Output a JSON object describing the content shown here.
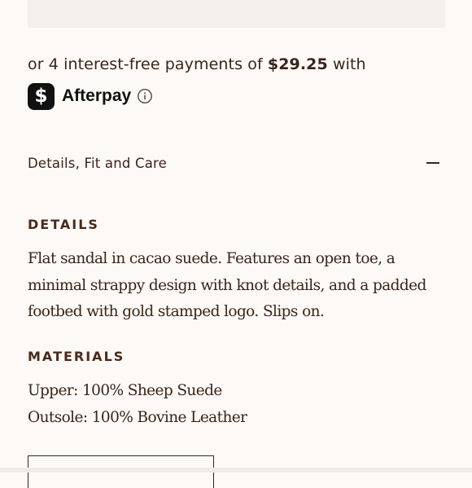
{
  "payment": {
    "prefix": "or 4 interest-free payments of ",
    "amount": "$29.25",
    "suffix": " with"
  },
  "afterpay": {
    "icon_glyph": "$",
    "name": "Afterpay",
    "icon": "cash-app-icon",
    "info_icon": "info-icon"
  },
  "accordion": {
    "title": "Details, Fit and Care",
    "toggle_icon": "minus-icon"
  },
  "details": {
    "heading": "DETAILS",
    "text": "Flat sandal in cacao suede. Features an open toe, a minimal strappy design with knot details, and a padded footbed with gold stamped logo. Slips on."
  },
  "materials": {
    "heading": "MATERIALS",
    "items": [
      "Upper: 100% Sheep Suede",
      "Outsole: 100% Bovine Leather"
    ]
  },
  "colors": {
    "background": "#fcf9f6",
    "text": "#3a2418",
    "panel": "#f3efea"
  }
}
